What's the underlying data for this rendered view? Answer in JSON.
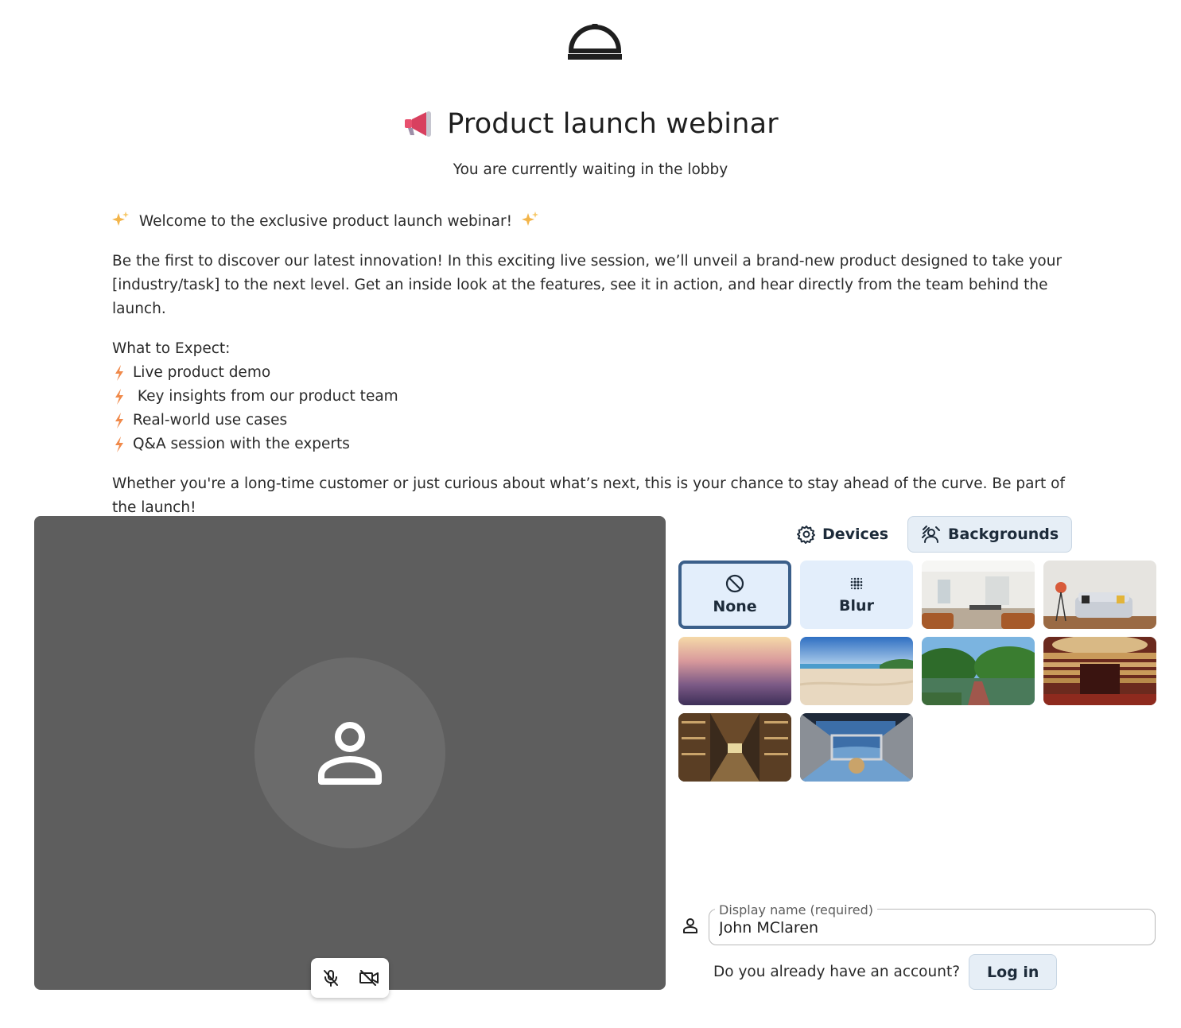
{
  "header": {
    "title": "Product launch webinar",
    "subtitle": "You are currently waiting in the lobby"
  },
  "description": {
    "welcome": "Welcome to the exclusive product launch webinar!",
    "intro": "Be the first to discover our latest innovation! In this exciting live session, we’ll unveil a brand-new product designed to take your [industry/task] to the next level. Get an inside look at the features, see it in action, and hear directly from the team behind the launch.",
    "expect_heading": "What to Expect:",
    "bullets": [
      "Live product demo",
      " Key insights from our product team",
      "Real-world use cases",
      "Q&A session with the experts"
    ],
    "closing": "Whether you're a long-time customer or just curious about what’s next, this is your chance to stay ahead of the curve. Be part of the launch!"
  },
  "tabs": {
    "devices": "Devices",
    "backgrounds": "Backgrounds",
    "active": "backgrounds"
  },
  "backgrounds": {
    "none_label": "None",
    "blur_label": "Blur",
    "selected": "none",
    "images": [
      "office-loft",
      "living-room-sofa",
      "sunset-gradient",
      "beach",
      "park-bridge",
      "opera-house",
      "library",
      "space-station"
    ]
  },
  "form": {
    "display_name_label": "Display name (required)",
    "display_name_value": "John MClaren",
    "account_question": "Do you already have an account?",
    "login_label": "Log in"
  },
  "icons": {
    "logo": "service-bell-icon",
    "title_emoji": "megaphone-icon",
    "sparkle": "sparkles-icon",
    "bullet": "lightning-bolt-icon"
  },
  "colors": {
    "preview_bg": "#5e5e5e",
    "avatar_bg": "#6b6b6b",
    "tile_bg": "#e3eefb",
    "selected_border": "#3b5f8a",
    "button_bg": "#e6eef6"
  }
}
